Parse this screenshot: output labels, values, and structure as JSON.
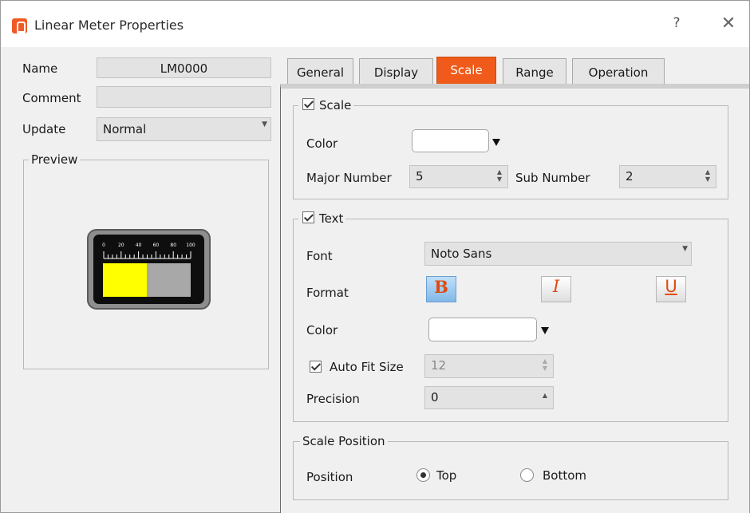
{
  "window": {
    "title": "Linear Meter Properties",
    "help": "?",
    "close": "✕"
  },
  "left": {
    "name_label": "Name",
    "name_value": "LM0000",
    "comment_label": "Comment",
    "comment_value": "",
    "update_label": "Update",
    "update_value": "Normal",
    "preview_label": "Preview",
    "meter_ticks": [
      "0",
      "20",
      "40",
      "60",
      "80",
      "100"
    ],
    "meter_level": 0.5
  },
  "tabs": [
    {
      "label": "General",
      "active": false
    },
    {
      "label": "Display",
      "active": false
    },
    {
      "label": "Scale",
      "active": true
    },
    {
      "label": "Range",
      "active": false
    },
    {
      "label": "Operation",
      "active": false
    }
  ],
  "scale": {
    "group_label": "Scale",
    "checked": true,
    "color_label": "Color",
    "color_value": "#ffffff",
    "major_label": "Major Number",
    "major_value": "5",
    "sub_label": "Sub Number",
    "sub_value": "2"
  },
  "text": {
    "group_label": "Text",
    "checked": true,
    "font_label": "Font",
    "font_value": "Noto Sans",
    "format_label": "Format",
    "bold": "B",
    "italic": "I",
    "underline": "U",
    "color_label": "Color",
    "color_value": "#ffffff",
    "autofit_label": "Auto Fit Size",
    "autofit_checked": true,
    "autofit_value": "12",
    "precision_label": "Precision",
    "precision_value": "0"
  },
  "position": {
    "group_label": "Scale Position",
    "label": "Position",
    "options": [
      "Top",
      "Bottom"
    ],
    "selected": "Top"
  },
  "colors": {
    "accent": "#f05a1a",
    "meter_fill": "#ffff00",
    "meter_empty": "#a8a8a8"
  }
}
